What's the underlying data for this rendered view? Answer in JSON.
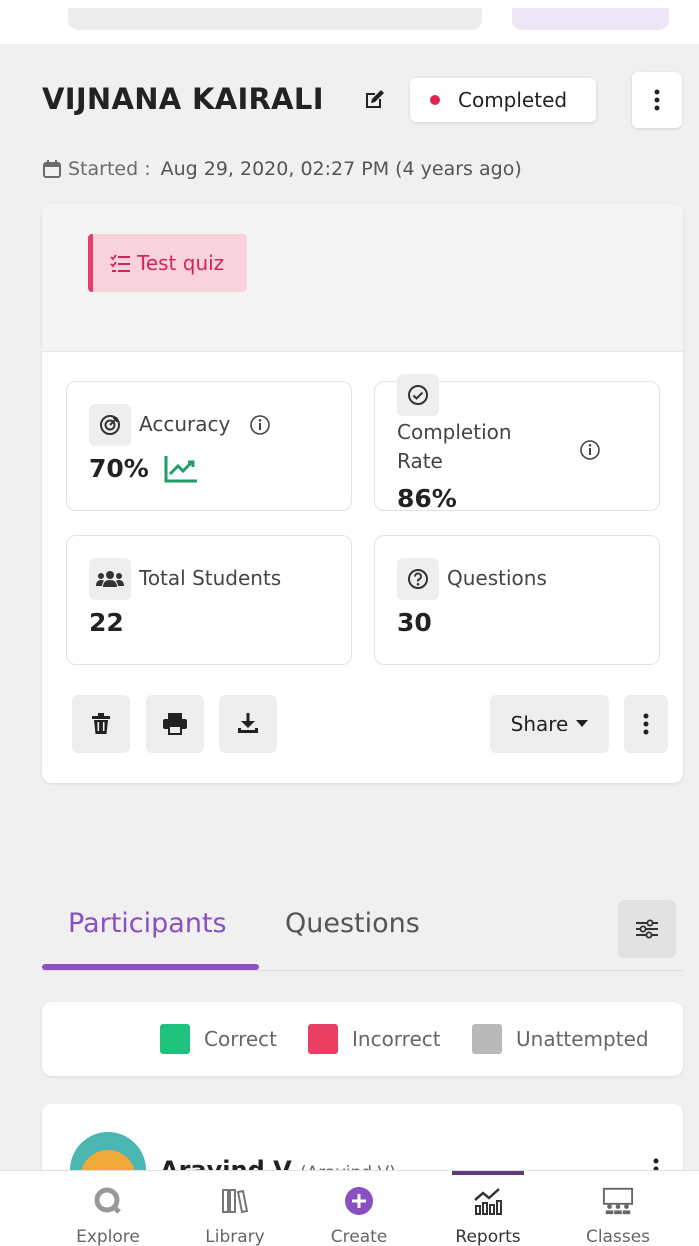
{
  "quiz": {
    "title": "VIJNANA KAIRALI",
    "status": "Completed",
    "started_label": "Started :",
    "started_value": "Aug 29, 2020, 02:27 PM (4 years ago)",
    "tag_label": "Test quiz"
  },
  "stats": {
    "accuracy_label": "Accuracy",
    "accuracy_value": "70%",
    "completion_label_line1": "Completion",
    "completion_label_line2": "Rate",
    "completion_value": "86%",
    "students_label": "Total Students",
    "students_value": "22",
    "questions_label": "Questions",
    "questions_value": "30"
  },
  "actions": {
    "share_label": "Share"
  },
  "tabs": {
    "participants": "Participants",
    "questions": "Questions"
  },
  "legend": {
    "correct": "Correct",
    "incorrect": "Incorrect",
    "unattempted": "Unattempted"
  },
  "participant": {
    "name": "Aravind V",
    "sub": "(Aravind V)"
  },
  "nav": {
    "explore": "Explore",
    "library": "Library",
    "create": "Create",
    "reports": "Reports",
    "classes": "Classes"
  },
  "colors": {
    "accent": "#8a4fc0",
    "status_dot": "#e0234f",
    "correct": "#1fc27d",
    "incorrect": "#ea3f63",
    "unattempted": "#b9b9b9",
    "trend": "#1f9e6a"
  },
  "icons": {
    "edit": "edit-icon",
    "calendar": "calendar-icon",
    "quiz": "quiz-list-icon",
    "accuracy": "target-icon",
    "completion": "check-circle-icon",
    "students": "people-icon",
    "questions": "question-circle-icon",
    "info": "info-icon",
    "trend": "trend-up-icon"
  }
}
